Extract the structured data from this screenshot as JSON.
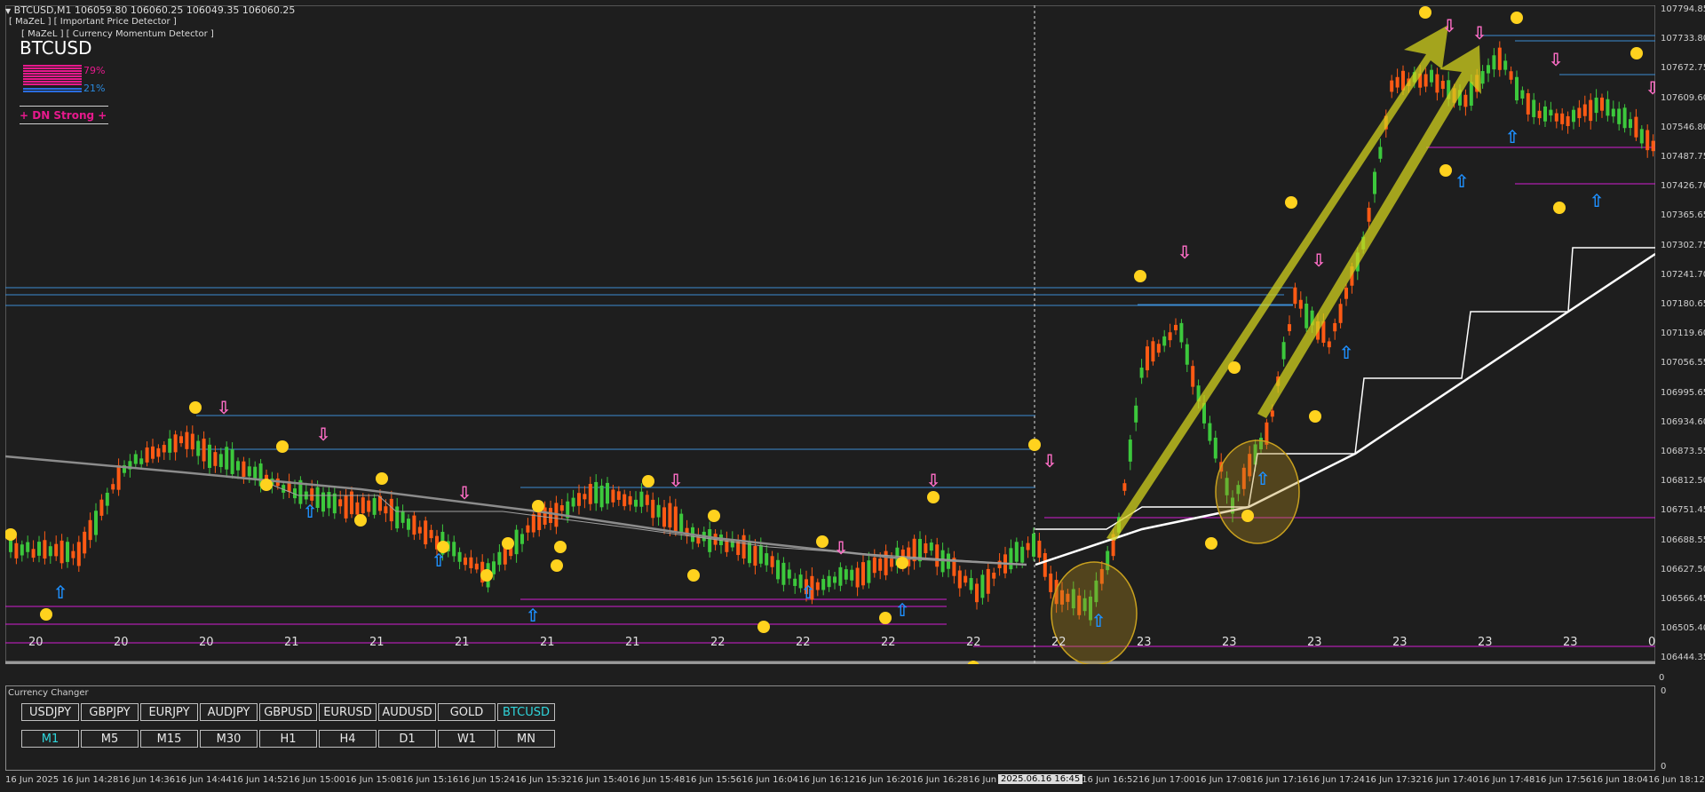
{
  "header": {
    "symbol_line": "BTCUSD,M1  106059.80 106060.25 106049.35 106060.25",
    "indicator1": "[ MaZeL ] [ Important Price Detector ]",
    "indicator2": "[ MaZeL ] [ Currency Momentum Detector ]"
  },
  "momentum_panel": {
    "symbol": "BTCUSD",
    "pct_down": "79%",
    "pct_up": "21%",
    "down_fraction": 0.79,
    "up_fraction": 0.21,
    "signal": "+ DN Strong +",
    "down_color": "#e6198c",
    "up_color": "#2a6de0"
  },
  "price_axis": [
    "107794.85",
    "107733.80",
    "107672.75",
    "107609.60",
    "107546.80",
    "107487.75",
    "107426.70",
    "107365.65",
    "107302.75",
    "107241.70",
    "107180.65",
    "107119.60",
    "107056.55",
    "106995.65",
    "106934.60",
    "106873.55",
    "106812.50",
    "106751.45",
    "106688.55",
    "106627.50",
    "106566.45",
    "106505.40",
    "106444.35"
  ],
  "day_labels": [
    "20",
    "20",
    "20",
    "21",
    "21",
    "21",
    "21",
    "21",
    "22",
    "22",
    "22",
    "22",
    "22",
    "23",
    "23",
    "23",
    "23",
    "23",
    "23",
    "0",
    "0"
  ],
  "time_labels": [
    "16 Jun 2025",
    "16 Jun 14:28",
    "16 Jun 14:36",
    "16 Jun 14:44",
    "16 Jun 14:52",
    "16 Jun 15:00",
    "16 Jun 15:08",
    "16 Jun 15:16",
    "16 Jun 15:24",
    "16 Jun 15:32",
    "16 Jun 15:40",
    "16 Jun 15:48",
    "16 Jun 15:56",
    "16 Jun 16:04",
    "16 Jun 16:12",
    "16 Jun 16:20",
    "16 Jun 16:28",
    "16 Jun 16:36",
    "16 Jun 16:44",
    "16 Jun 16:52",
    "16 Jun 17:00",
    "16 Jun 17:08",
    "16 Jun 17:16",
    "16 Jun 17:24",
    "16 Jun 17:32",
    "16 Jun 17:40",
    "16 Jun 17:48",
    "16 Jun 17:56",
    "16 Jun 18:04",
    "16 Jun 18:12"
  ],
  "cursor_time": "2025.06.16 16:45",
  "currency_changer": {
    "title": "Currency Changer",
    "symbols": [
      "USDJPY",
      "GBPJPY",
      "EURJPY",
      "AUDJPY",
      "GBPUSD",
      "EURUSD",
      "AUDUSD",
      "GOLD",
      "BTCUSD"
    ],
    "active_symbol": "BTCUSD",
    "timeframes": [
      "M1",
      "M5",
      "M15",
      "M30",
      "H1",
      "H4",
      "D1",
      "W1",
      "MN"
    ],
    "active_timeframe": "M1",
    "scale_top": "100",
    "scale_bottom": "0",
    "scale_top_right": "0"
  },
  "colors": {
    "bull": "#3cc83c",
    "bear": "#ff5a14",
    "signal_down": "#ff6ec7",
    "signal_up": "#1e90ff",
    "marker": "#ffd21e",
    "support": "#d21ed2",
    "resistance": "#3c8cd2",
    "trend": "#ffffff",
    "ma": "#8c8c8c",
    "highlight": "#d2d21e"
  }
}
